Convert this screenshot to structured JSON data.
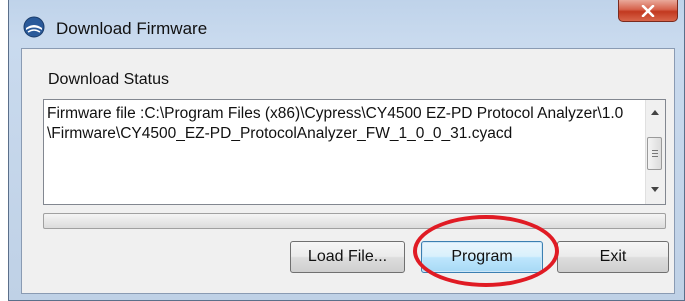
{
  "window": {
    "title": "Download Firmware",
    "app_icon": "cypress-app-icon",
    "close_icon": "close-icon"
  },
  "status": {
    "label": "Download Status",
    "text": "Firmware file :C:\\Program Files (x86)\\Cypress\\CY4500 EZ-PD Protocol Analyzer\\1.0\\Firmware\\CY4500_EZ-PD_ProtocolAnalyzer_FW_1_0_0_31.cyacd"
  },
  "progress": {
    "value": 0
  },
  "buttons": {
    "load_file": "Load File...",
    "program": "Program",
    "exit": "Exit"
  },
  "colors": {
    "annotation": "#e01b24",
    "title_bar": "#c9daee",
    "close_button": "#c2381f"
  }
}
